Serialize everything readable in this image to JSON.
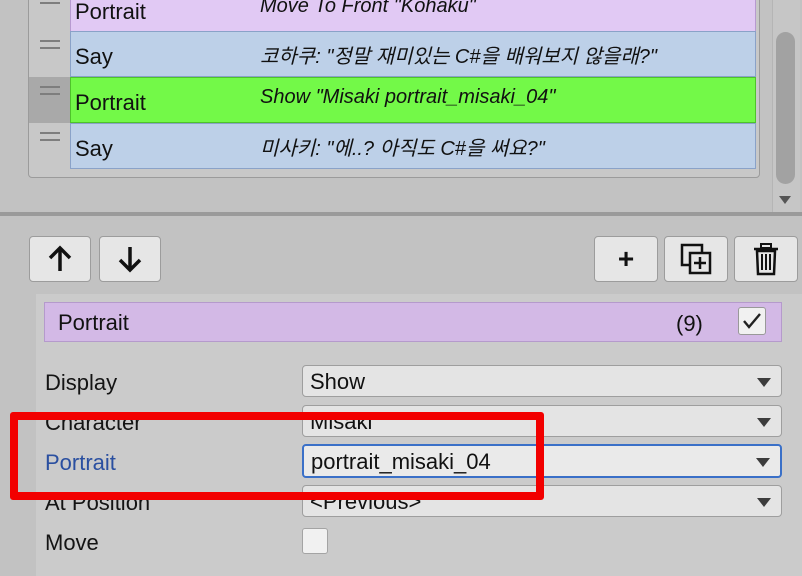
{
  "colors": {
    "purple_row": "#e1c9f4",
    "blue_row": "#bdd0e8",
    "green_row": "#73f948",
    "inspector_header": "#d3b9e6",
    "highlight_red": "#f20000",
    "focused_label": "#2a4fa0"
  },
  "command_list": {
    "rows": [
      {
        "command": "Portrait",
        "description": "Move To Front \"Kohaku\"",
        "style": "purple"
      },
      {
        "command": "Say",
        "description": "코하쿠: \"정말 재미있는 C#을 배워보지 않을래?\"",
        "style": "blue"
      },
      {
        "command": "Portrait",
        "description": "Show \"Misaki portrait_misaki_04\"",
        "style": "green",
        "selected": true
      },
      {
        "command": "Say",
        "description": "미사키: \"에..? 아직도 C#을 써요?\"",
        "style": "blue"
      }
    ]
  },
  "toolbar": {
    "icons": [
      "arrow-up-icon",
      "arrow-down-icon",
      "plus-icon",
      "duplicate-icon",
      "trash-icon"
    ],
    "add_label": "+"
  },
  "inspector": {
    "title": "Portrait",
    "index": "(9)",
    "enabled": true,
    "fields": {
      "display": {
        "label": "Display",
        "value": "Show"
      },
      "character": {
        "label": "Character",
        "value": "Misaki"
      },
      "portrait": {
        "label": "Portrait",
        "value": "portrait_misaki_04"
      },
      "at_position": {
        "label": "At Position",
        "value": "<Previous>"
      },
      "move": {
        "label": "Move",
        "checked": false
      }
    }
  }
}
